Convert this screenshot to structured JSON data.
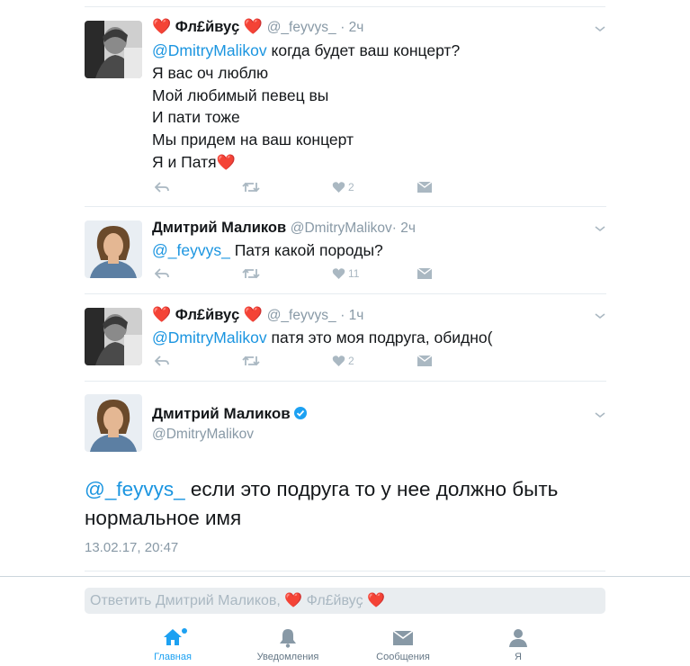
{
  "tweets": [
    {
      "name": "Фл£йвуҫ",
      "handle": "@_feyvys_",
      "time": "· 2ч",
      "mention": "@DmitryMalikov",
      "text": " когда будет ваш концерт?\nЯ вас оч люблю\nМой любимый певец вы\nИ пати тоже\nМы придем на ваш концерт\nЯ и Патя",
      "text_heart": "❤️",
      "likes": "2",
      "name_heart": "❤️"
    },
    {
      "name": "Дмитрий Маликов",
      "handle": "@DmitryMalikov",
      "time": "· 2ч",
      "mention": "@_feyvys_",
      "text": " Патя какой породы?",
      "likes": "11"
    },
    {
      "name": "Фл£йвуҫ",
      "handle": "@_feyvys_",
      "time": "· 1ч",
      "mention": "@DmitryMalikov",
      "text": " патя это моя подруга, обидно(",
      "likes": "2",
      "name_heart": "❤️"
    }
  ],
  "focused": {
    "name": "Дмитрий Маликов",
    "handle": "@DmitryMalikov",
    "mention": "@_feyvys_",
    "text": " если это подруга то у нее должно быть нормальное имя",
    "date": "13.02.17, 20:47"
  },
  "reply": {
    "placeholder": "Ответить Дмитрий Маликов, ",
    "name": " Фл£йвуҫ ",
    "heart": "❤️"
  },
  "tabs": {
    "home": "Главная",
    "notifications": "Уведомления",
    "messages": "Сообщения",
    "me": "Я"
  },
  "colors": {
    "accent": "#1da1f2",
    "mention": "#1b95e0",
    "heart": "#e0245e",
    "verified": "#1da1f2"
  },
  "icons": [
    "reply-icon",
    "retweet-icon",
    "like-icon",
    "dm-icon",
    "chevron-down-icon",
    "home-icon",
    "bell-icon",
    "envelope-icon",
    "person-icon",
    "verified-icon"
  ]
}
